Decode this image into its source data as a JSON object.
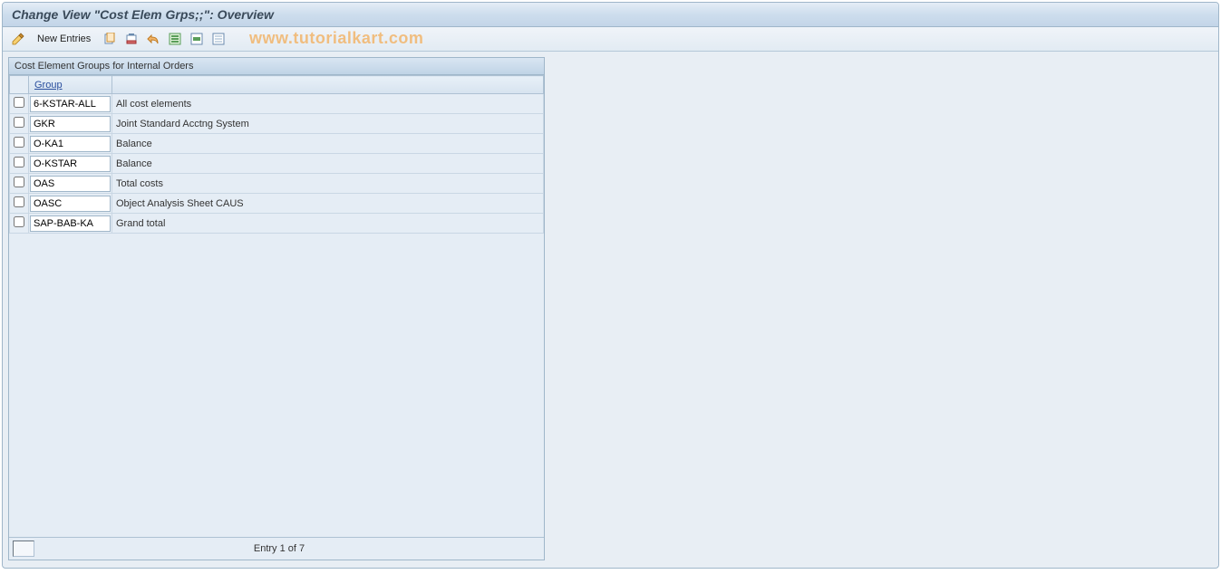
{
  "header": {
    "title": "Change View \"Cost Elem Grps;;\": Overview"
  },
  "toolbar": {
    "new_entries_label": "New Entries",
    "icons": {
      "edit": "edit-pencil-icon",
      "copy": "copy-icon",
      "delete": "delete-icon",
      "undo": "undo-icon",
      "select_all": "select-all-icon",
      "select_block": "select-block-icon",
      "deselect_all": "deselect-all-icon"
    }
  },
  "watermark": "www.tutorialkart.com",
  "panel": {
    "title": "Cost Element Groups for Internal Orders",
    "columns": {
      "group": "Group"
    },
    "rows": [
      {
        "group": "6-KSTAR-ALL",
        "description": "All cost elements"
      },
      {
        "group": "GKR",
        "description": "Joint Standard Acctng System"
      },
      {
        "group": "O-KA1",
        "description": "Balance"
      },
      {
        "group": "O-KSTAR",
        "description": "Balance"
      },
      {
        "group": "OAS",
        "description": "Total costs"
      },
      {
        "group": "OASC",
        "description": "Object Analysis Sheet CAUS"
      },
      {
        "group": "SAP-BAB-KA",
        "description": "Grand total"
      }
    ],
    "status": "Entry 1 of 7"
  }
}
